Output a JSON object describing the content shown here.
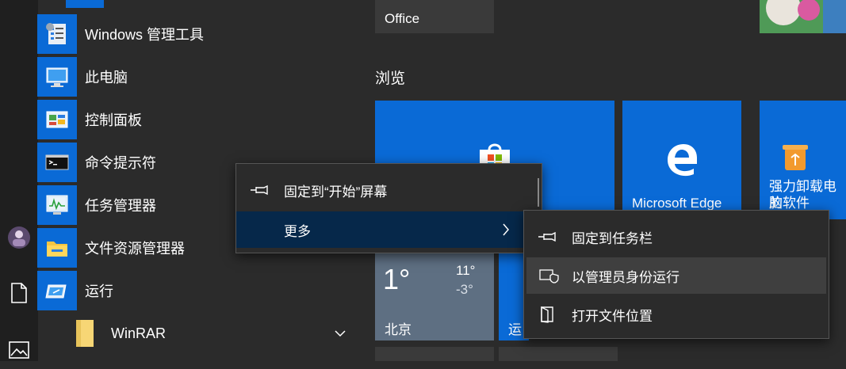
{
  "rail": {
    "items": [
      {
        "icon": "avatar"
      },
      {
        "icon": "document-icon"
      },
      {
        "icon": "pictures-icon"
      }
    ]
  },
  "apps": [
    {
      "label": "Windows 管理工具",
      "icon": "admin-tools-icon"
    },
    {
      "label": "此电脑",
      "icon": "this-pc-icon"
    },
    {
      "label": "控制面板",
      "icon": "control-panel-icon"
    },
    {
      "label": "命令提示符",
      "icon": "command-prompt-icon"
    },
    {
      "label": "任务管理器",
      "icon": "task-manager-icon"
    },
    {
      "label": "文件资源管理器",
      "icon": "file-explorer-icon"
    },
    {
      "label": "运行",
      "icon": "run-icon"
    }
  ],
  "group": {
    "label": "WinRAR",
    "icon": "folder-icon",
    "chevron": "chevron-down-icon"
  },
  "tiles": {
    "office_label": "Office",
    "section_title": "浏览",
    "edge_label": "Microsoft Edge",
    "uninstall_label_line1": "强力卸载电脑",
    "uninstall_label_line2": "的软件",
    "weather": {
      "temp": "1°",
      "high": "11°",
      "low": "-3°",
      "city": "北京"
    },
    "partial_label": "运"
  },
  "context_menu": {
    "pin_start": "固定到“开始”屏幕",
    "more": "更多"
  },
  "submenu": {
    "pin_taskbar": "固定到任务栏",
    "run_as_admin": "以管理员身份运行",
    "open_location": "打开文件位置"
  },
  "colors": {
    "accent": "#0a6ad6",
    "menu_highlight": "#06284a",
    "background": "#2b2b2b"
  }
}
